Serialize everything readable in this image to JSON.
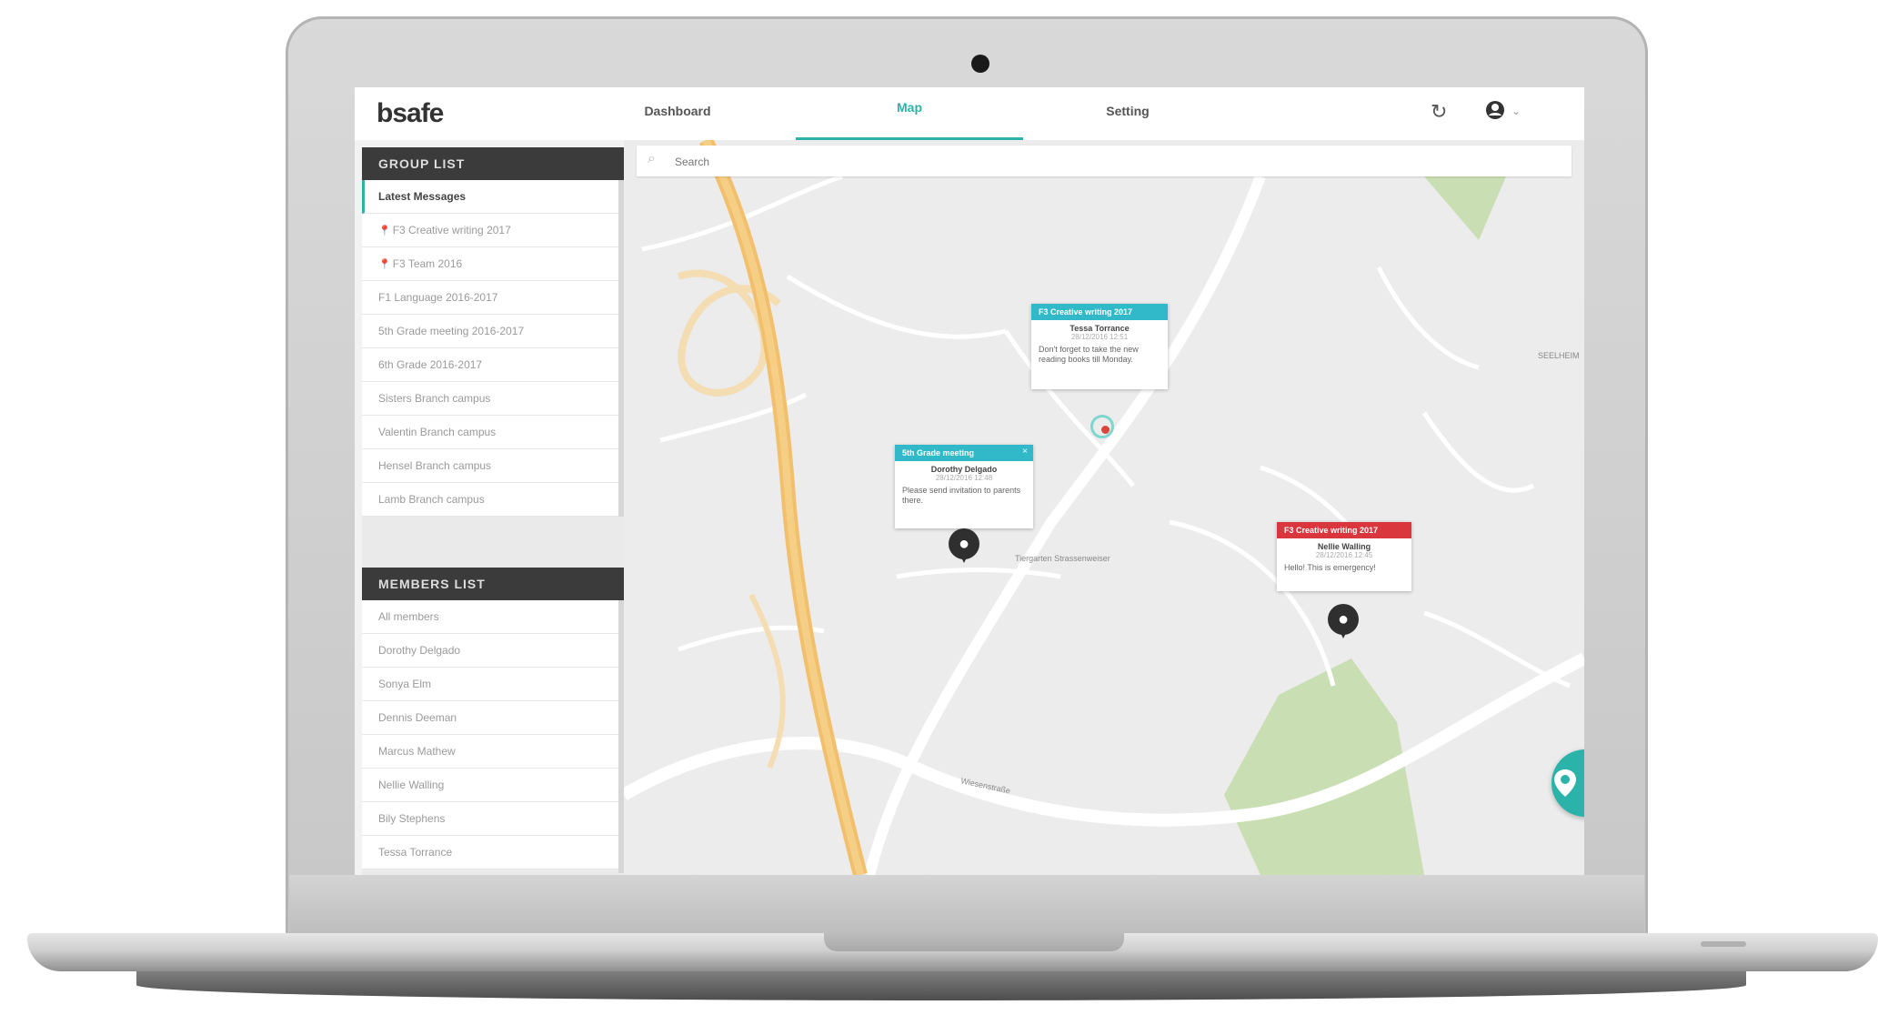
{
  "app": {
    "logo": "bsafe"
  },
  "nav": {
    "tabs": [
      {
        "label": "Dashboard"
      },
      {
        "label": "Map"
      },
      {
        "label": "Setting"
      }
    ],
    "active_tab": "Map",
    "refresh_icon": "refresh-icon",
    "profile_icon": "user-icon"
  },
  "search": {
    "placeholder": "Search"
  },
  "group_list": {
    "title": "GROUP LIST",
    "items": [
      "Latest Messages",
      "F3 Creative writing 2017",
      "F3 Team 2016",
      "F1 Language 2016-2017",
      "5th Grade meeting 2016-2017",
      "6th Grade 2016-2017",
      "Sisters Branch campus",
      "Valentin Branch campus",
      "Hensel Branch campus",
      "Lamb Branch campus"
    ]
  },
  "members_list": {
    "title": "MEMBERS LIST",
    "items": [
      "All members",
      "Dorothy Delgado",
      "Sonya Elm",
      "Dennis Deeman",
      "Marcus Mathew",
      "Nellie Walling",
      "Bily Stephens",
      "Tessa Torrance"
    ]
  },
  "map": {
    "cards": [
      {
        "header": "F3 Creative writing 2017",
        "name": "Tessa Torrance",
        "date": "28/12/2016 12:51",
        "message": "Don't forget to take the new reading books till Monday.",
        "color": "#31b9c9"
      },
      {
        "header": "5th Grade meeting",
        "name": "Dorothy Delgado",
        "date": "28/12/2016 12:48",
        "message": "Please send invitation to parents there.",
        "color": "#31b9c9"
      },
      {
        "header": "F3 Creative writing 2017",
        "name": "Nellie Walling",
        "date": "28/12/2016 12:45",
        "message": "Hello! This is emergency!",
        "color": "#d9363e"
      }
    ],
    "road_labels": [
      "Tiergarten Strassenweiser",
      "Wiesenstraße",
      "SEELHEIM"
    ],
    "fab_icon": "location-pin-icon"
  },
  "colors": {
    "accent": "#2bb3aa",
    "dark_header": "#3b3b3b",
    "alert": "#d9363e",
    "info": "#31b9c9"
  }
}
